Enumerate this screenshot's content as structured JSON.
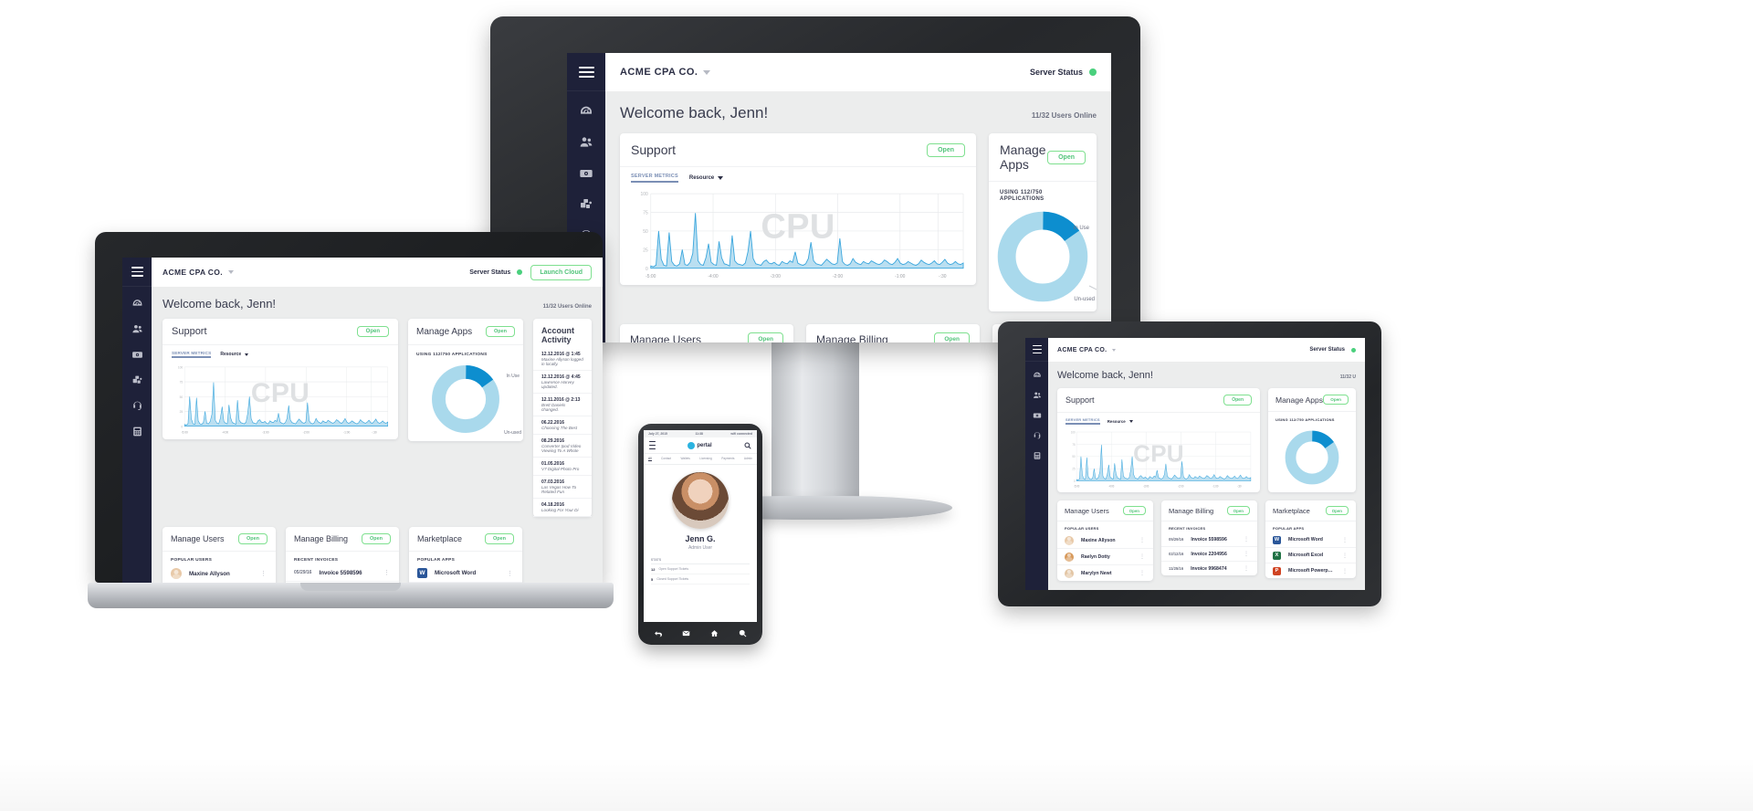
{
  "app": {
    "brand": "ACME CPA CO.",
    "server_status_label": "Server Status",
    "status_color": "#4ad07d",
    "launch_button": "Launch Cloud",
    "welcome": "Welcome back, Jenn!",
    "users_online": "11/32 Users Online",
    "users_online_short": "11/32 U",
    "menu_icon": "hamburger-icon",
    "nav_icons": [
      "dashboard-gauge-icon",
      "users-icon",
      "money-icon",
      "boxes-icon",
      "headset-icon",
      "calculator-icon"
    ]
  },
  "support": {
    "title": "Support",
    "open_label": "Open",
    "tab_metrics": "SERVER METRICS",
    "tab_resource": "Resource",
    "watermark": "CPU"
  },
  "apps": {
    "title": "Manage Apps",
    "open_label": "Open",
    "subtitle": "USING 112/750 APPLICATIONS",
    "label_in_use": "In Use",
    "label_unused": "Un-used",
    "color_in_use": "#0d8ecf",
    "color_unused": "#a9d9ec"
  },
  "users": {
    "title": "Manage Users",
    "open_label": "Open",
    "subtitle": "POPULAR USERS",
    "kebab": "⋮",
    "items": [
      {
        "name": "Maxine Allyson",
        "avatar": "#e8c9a8"
      },
      {
        "name": "Raelyn Dotty",
        "avatar": "#d89a5c"
      },
      {
        "name": "Marylyn Newt",
        "avatar": "#e3c6a5"
      }
    ]
  },
  "billing": {
    "title": "Manage Billing",
    "open_label": "Open",
    "subtitle": "RECENT INVOICES",
    "kebab": "⋮",
    "items": [
      {
        "date": "05/29/16",
        "name": "Invoice 5598596"
      },
      {
        "date": "02/12/16",
        "name": "Invoice 2204956"
      },
      {
        "date": "11/25/16",
        "name": "Invoice 9968474"
      }
    ]
  },
  "marketplace": {
    "title": "Marketplace",
    "open_label": "Open",
    "subtitle": "POPULAR APPS",
    "kebab": "⋮",
    "items": [
      {
        "name": "Microsoft Word",
        "abbr": "W",
        "color": "#2a5699"
      },
      {
        "name": "Microsoft Excel",
        "abbr": "X",
        "color": "#207245"
      },
      {
        "name": "Microsoft Powerpoint",
        "abbr": "P",
        "color": "#d04423"
      }
    ]
  },
  "activity": {
    "title": "Account Activity",
    "items": [
      {
        "date": "12.12.2016 @ 1:45",
        "text": "Maxine Allyson logged in locally."
      },
      {
        "date": "12.12.2016 @ 4:45",
        "text": "Lawrence Harvey updated."
      },
      {
        "date": "12.11.2016 @ 2:13",
        "text": "Brett Daniels changed."
      },
      {
        "date": "06.22.2016",
        "text": "Choosing The Best"
      },
      {
        "date": "08.29.2016",
        "text": "Converter Ipod Video Viewing To A Whole"
      },
      {
        "date": "01.05.2016",
        "text": "V7 Digital Photo Pro"
      },
      {
        "date": "07.03.2016",
        "text": "Las Vegas How To Related Fun"
      },
      {
        "date": "04.18.2016",
        "text": "Looking For Your Di"
      }
    ]
  },
  "phone": {
    "status_date": "July 27, 2015",
    "status_time": "11:38",
    "status_right": "wifi connected",
    "logo_text": "pertal",
    "search_icon": "search-icon",
    "menu_icon": "hamburger-icon",
    "tabs": [
      "All",
      "Contact",
      "Wallets",
      "Licensing",
      "Payments",
      "Admin"
    ],
    "profile_name": "Jenn G.",
    "profile_role": "Admin User",
    "section_title": "STATS",
    "stats": [
      {
        "value": "12",
        "label": "Open Support Tickets"
      },
      {
        "value": "5",
        "label": "Closed Support Tickets"
      }
    ],
    "nav_icons": [
      "back-icon",
      "mail-icon",
      "home-icon",
      "search-icon"
    ]
  },
  "chart_data": {
    "type": "area",
    "title": "CPU",
    "xlabel": "",
    "ylabel": "",
    "ylim": [
      0,
      100
    ],
    "yticks": [
      0,
      25,
      50,
      75,
      100
    ],
    "xticks": [
      "-5:00",
      "-4:00",
      "-3:00",
      "-2:00",
      "-1:00",
      "-:30"
    ],
    "grid": true,
    "series": [
      {
        "name": "CPU %",
        "color": "#3aa6dd",
        "fill": "#aed9ef",
        "values": [
          3,
          2,
          4,
          50,
          12,
          4,
          3,
          48,
          9,
          4,
          3,
          6,
          25,
          5,
          4,
          8,
          20,
          74,
          10,
          5,
          4,
          14,
          33,
          8,
          5,
          4,
          36,
          14,
          6,
          5,
          3,
          44,
          10,
          6,
          5,
          4,
          7,
          22,
          50,
          13,
          6,
          5,
          4,
          9,
          11,
          7,
          6,
          8,
          5,
          4,
          9,
          7,
          6,
          10,
          8,
          22,
          7,
          5,
          4,
          6,
          13,
          35,
          10,
          6,
          5,
          4,
          8,
          12,
          9,
          6,
          5,
          7,
          40,
          9,
          5,
          4,
          6,
          13,
          8,
          6,
          5,
          9,
          7,
          6,
          10,
          8,
          6,
          5,
          7,
          11,
          9,
          6,
          5,
          8,
          13,
          7,
          5,
          6,
          9,
          7,
          5,
          4,
          6,
          11,
          8,
          6,
          5,
          7,
          10,
          6,
          5,
          8,
          12,
          7,
          5,
          6,
          9,
          6,
          5,
          7
        ]
      }
    ],
    "donut": {
      "type": "pie",
      "title": "USING 112/750 APPLICATIONS",
      "categories": [
        "In Use",
        "Un-used"
      ],
      "values": [
        112,
        638
      ],
      "colors": [
        "#0d8ecf",
        "#a9d9ec"
      ]
    }
  }
}
